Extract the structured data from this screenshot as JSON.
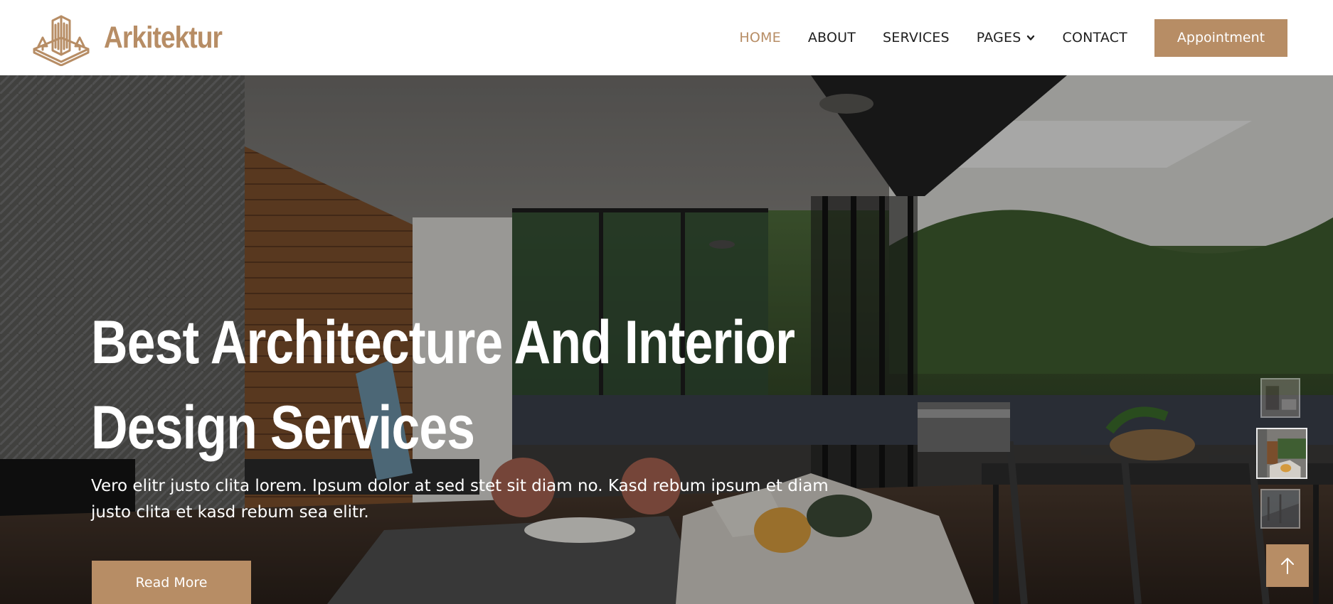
{
  "brand": {
    "name": "Arkitektur",
    "logo_icon": "building-icon",
    "color": "#b78d65"
  },
  "nav": {
    "items": [
      {
        "label": "HOME",
        "active": true
      },
      {
        "label": "ABOUT",
        "active": false
      },
      {
        "label": "SERVICES",
        "active": false
      },
      {
        "label": "PAGES",
        "active": false,
        "dropdown": true
      },
      {
        "label": "CONTACT",
        "active": false
      }
    ],
    "appointment_label": "Appointment"
  },
  "hero": {
    "title_line1": "Best Architecture And Interior",
    "title_line2": "Design Services",
    "text": "Vero elitr justo clita lorem. Ipsum dolor at sed stet sit diam no. Kasd rebum ipsum et diam justo clita et kasd rebum sea elitr.",
    "read_more_label": "Read More",
    "slide_thumbnails": 3,
    "active_slide": 2
  },
  "back_to_top": {
    "icon": "arrow-up-icon"
  },
  "colors": {
    "accent": "#b78d65",
    "nav_text": "#1f1f1f",
    "hero_text": "#ffffff"
  }
}
